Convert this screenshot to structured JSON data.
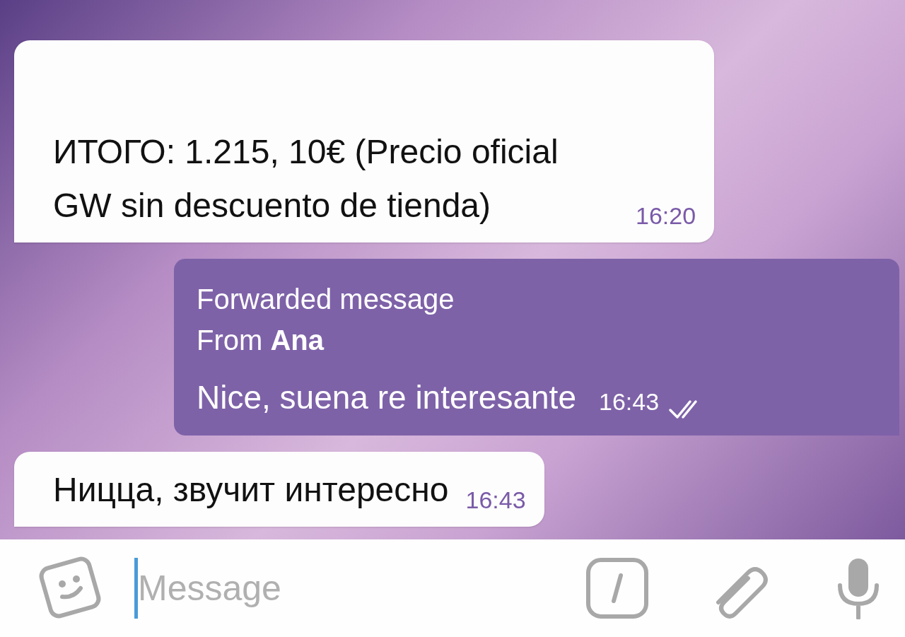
{
  "messages": [
    {
      "kind": "in",
      "text": "ИТОГО: 1.215, 10€ (Precio oficial GW sin descuento de tienda)",
      "time": "16:20"
    },
    {
      "kind": "out",
      "forwarded": {
        "label": "Forwarded message",
        "from_prefix": "From",
        "from_name": "Ana"
      },
      "text": "Nice, suena re interesante",
      "time": "16:43",
      "read": true
    },
    {
      "kind": "in",
      "text": "Ницца, звучит интересно",
      "time": "16:43"
    }
  ],
  "composer": {
    "placeholder": "Message"
  }
}
